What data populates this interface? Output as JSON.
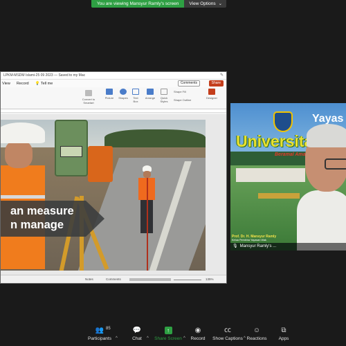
{
  "banner": {
    "share_text": "You are viewing Mansyur Ramly's screen",
    "view_options": "View Options"
  },
  "ppt": {
    "doc_title": "LPKM-MSDM Islami-25 09 2023 — Saved to my Mac",
    "menu": [
      "View",
      "Record",
      "Tell me"
    ],
    "comments_label": "Comments",
    "share_label": "Share",
    "ribbon": {
      "convert": "Convert to Smartart",
      "picture": "Picture",
      "shapes": "Shapes",
      "text_box": "Text Box",
      "arrange": "Arrange",
      "quick_styles": "Quick Styles",
      "shape_fill": "Shape Fill",
      "shape_outline": "Shape Outline",
      "designer": "Designer"
    },
    "slide_caption_line1": "an measure",
    "slide_caption_line2": "n manage",
    "status": {
      "notes": "Notes",
      "comments": "Comments",
      "zoom": "135%"
    }
  },
  "video": {
    "yayasan": "Yayas",
    "university": "Universitas",
    "motto": "Beramal Amaliah - Berd",
    "prof_name": "Prof. Dr. H. Mansyur Ramly",
    "prof_role": "Ketua Pembina Yayasan Wak",
    "participant_name": "Mansyur Ramly's ..."
  },
  "toolbar": {
    "participants": "Participants",
    "participant_count": "85",
    "chat": "Chat",
    "share": "Share Screen",
    "record": "Record",
    "captions": "Show Captions",
    "reactions": "Reactions",
    "apps": "Apps"
  },
  "colors": {
    "share_green": "#2ea043",
    "ppt_accent": "#c43e1c"
  }
}
